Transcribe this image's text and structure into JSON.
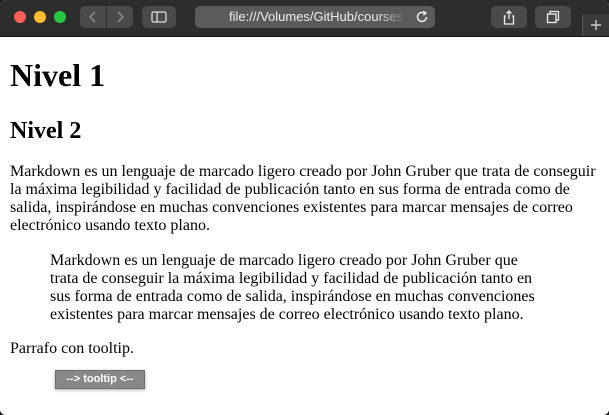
{
  "browser": {
    "address_text": "file:///Volumes/GitHub/courses",
    "icons": {
      "back": "chevron-left-icon",
      "forward": "chevron-right-icon",
      "sidebar": "sidebar-icon",
      "reload": "reload-icon",
      "share": "share-icon",
      "tabs": "tabs-icon",
      "new_tab": "plus-icon"
    },
    "colors": {
      "close": "#ff5f57",
      "minimize": "#febc2e",
      "zoom": "#28c840"
    }
  },
  "page": {
    "h1": "Nivel 1",
    "h2": "Nivel 2",
    "paragraph": "Markdown es un lenguaje de marcado ligero creado por John Gruber que trata de conseguir la máxima legibilidad y facilidad de publicación tanto en sus forma de entrada como de salida, inspirándose en muchas convenciones existentes para marcar mensajes de correo electrónico usando texto plano.",
    "blockquote": "Markdown es un lenguaje de marcado ligero creado por John Gruber que trata de conseguir la máxima legibilidad y facilidad de publicación tanto en sus forma de entrada como de salida, inspirándose en muchas convenciones existentes para marcar mensajes de correo electrónico usando texto plano.",
    "tooltip_paragraph": "Parrafo con tooltip.",
    "tooltip_text": "--> tooltip <--"
  }
}
